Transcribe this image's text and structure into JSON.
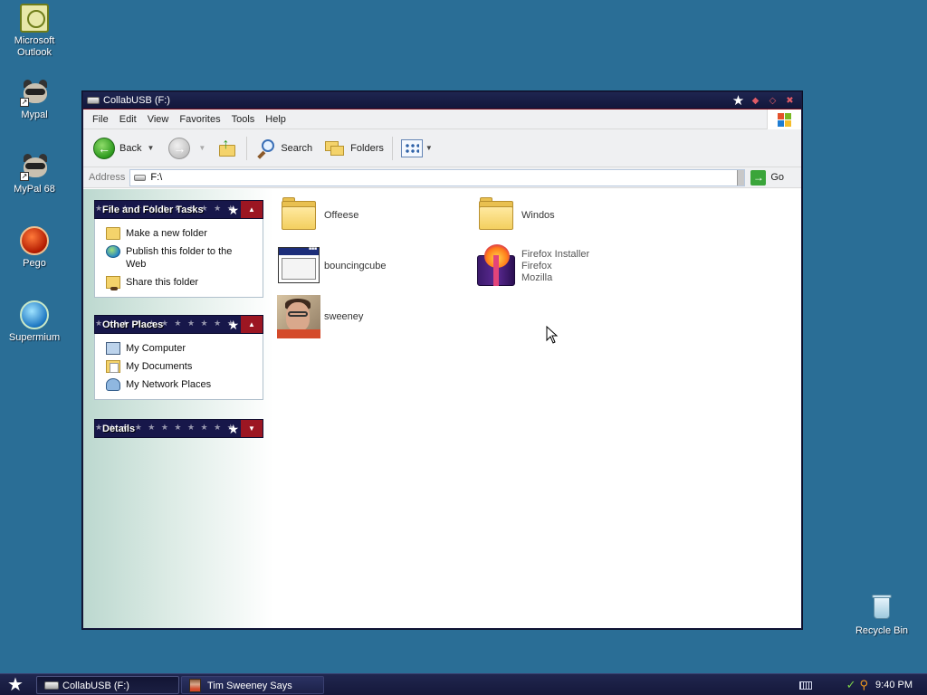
{
  "desktop": {
    "icons": [
      {
        "label": "Microsoft\nOutlook",
        "icon": "outlook-icon"
      },
      {
        "label": "Mypal",
        "icon": "raccoon-icon"
      },
      {
        "label": "MyPal 68",
        "icon": "raccoon-icon"
      },
      {
        "label": "Pego",
        "icon": "pego-icon"
      },
      {
        "label": "Supermium",
        "icon": "supermium-icon"
      },
      {
        "label": "Recycle Bin",
        "icon": "recycle-bin-icon"
      }
    ]
  },
  "window": {
    "title": "CollabUSB (F:)",
    "menu": [
      "File",
      "Edit",
      "View",
      "Favorites",
      "Tools",
      "Help"
    ],
    "toolbar": {
      "back_label": "Back",
      "search_label": "Search",
      "folders_label": "Folders"
    },
    "address": {
      "label": "Address",
      "value": "F:\\",
      "go_label": "Go"
    },
    "taskpane": {
      "file_tasks": {
        "title": "File and Folder Tasks",
        "items": [
          {
            "label": "Make a new folder",
            "icon": "new-folder-icon"
          },
          {
            "label": "Publish this folder to the Web",
            "icon": "publish-web-icon"
          },
          {
            "label": "Share this folder",
            "icon": "share-folder-icon"
          }
        ]
      },
      "other_places": {
        "title": "Other Places",
        "items": [
          {
            "label": "My Computer",
            "icon": "my-computer-icon"
          },
          {
            "label": "My Documents",
            "icon": "my-documents-icon"
          },
          {
            "label": "My Network Places",
            "icon": "network-places-icon"
          }
        ]
      },
      "details": {
        "title": "Details"
      }
    },
    "files": [
      {
        "name": "Offeese",
        "type": "folder"
      },
      {
        "name": "Windos",
        "type": "folder"
      },
      {
        "name": "bouncingcube",
        "type": "application"
      },
      {
        "name": "Firefox Installer",
        "line2": "Firefox",
        "line3": "Mozilla",
        "type": "installer"
      },
      {
        "name": "sweeney",
        "type": "image"
      }
    ]
  },
  "taskbar": {
    "buttons": [
      {
        "label": "CollabUSB (F:)",
        "active": true
      },
      {
        "label": "Tim Sweeney Says",
        "active": false
      }
    ],
    "clock": "9:40 PM"
  },
  "colors": {
    "desktop": "#2a6e96",
    "titlebar": "#1e2550",
    "panel_header": "#17174a",
    "panel_toggle": "#9c1622",
    "taskbar": "#20264f"
  }
}
